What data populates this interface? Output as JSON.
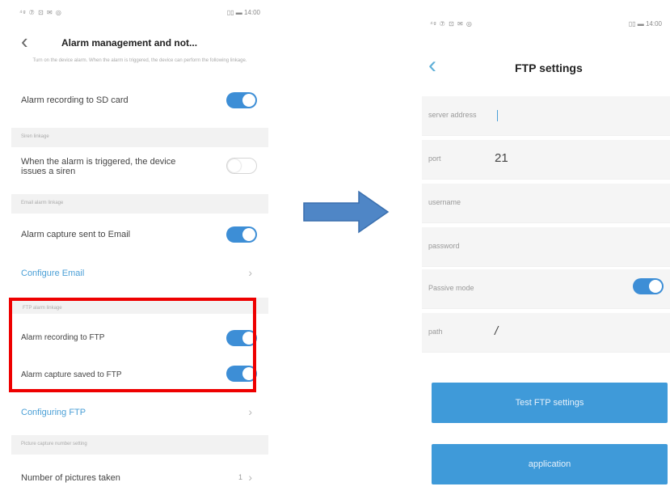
{
  "left_screen": {
    "status_left": "⁴ᵍ ⑦ ⊡ ✉ ◎",
    "status_right": "▯▯ ▬ 14:00",
    "back_icon": "‹",
    "title": "Alarm management and not...",
    "description": "Turn on the device alarm. When the alarm is triggered, the device can perform the following linkage.",
    "rows": {
      "sd_card": {
        "label": "Alarm recording to SD card",
        "toggle": true
      },
      "siren_section": "Siren linkage",
      "siren": {
        "label": "When the alarm is triggered, the device issues a siren",
        "toggle": false
      },
      "email_section": "Email alarm linkage",
      "email": {
        "label": "Alarm capture sent to Email",
        "toggle": true
      },
      "configure_email": "Configure Email",
      "ftp_section": "FTP alarm linkage",
      "ftp_record": {
        "label": "Alarm recording to FTP",
        "toggle": true
      },
      "ftp_capture": {
        "label": "Alarm capture saved to FTP",
        "toggle": true
      },
      "configuring_ftp": "Configuring FTP",
      "picture_section": "Picture capture number setting",
      "pictures": {
        "label": "Number of pictures taken",
        "value": "1"
      }
    },
    "chevron": "›"
  },
  "arrow_color": "#4f86c6",
  "right_screen": {
    "status_left": "⁴ᵍ ⑦ ⊡ ✉ ◎",
    "status_right": "▯▯ ▬ 14:00",
    "back_icon": "‹",
    "title": "FTP settings",
    "fields": {
      "server": {
        "label": "server address",
        "value": ""
      },
      "port": {
        "label": "port",
        "value": "21"
      },
      "username": {
        "label": "username",
        "value": ""
      },
      "password": {
        "label": "password",
        "value": ""
      },
      "passive": {
        "label": "Passive mode",
        "toggle": true
      },
      "path": {
        "label": "path",
        "value": "/"
      }
    },
    "test_button": "Test FTP settings",
    "apply_button": "application"
  },
  "colors": {
    "accent": "#3d8ed6",
    "link": "#4a9fd6",
    "highlight": "#ee0000",
    "button": "#3f9ad9"
  }
}
